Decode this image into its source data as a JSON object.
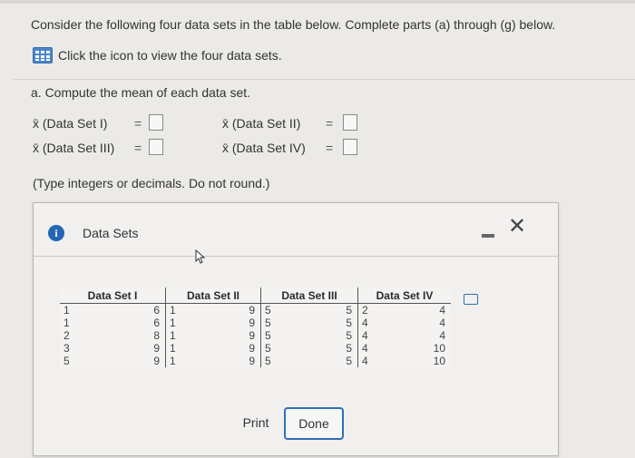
{
  "question": {
    "instruction": "Consider the following four data sets in the table below. Complete parts (a) through (g) below.",
    "click_text": "Click the icon to view the four data sets.",
    "part_a": "a. Compute the mean of each data set.",
    "means": [
      {
        "label": "x̄ (Data Set I)",
        "eq": "="
      },
      {
        "label": "x̄ (Data Set II)",
        "eq": "="
      },
      {
        "label": "x̄ (Data Set III)",
        "eq": "="
      },
      {
        "label": "x̄ (Data Set IV)",
        "eq": "="
      }
    ],
    "hint": "(Type integers or decimals. Do not round.)"
  },
  "modal": {
    "title": "Data Sets",
    "info_glyph": "i",
    "close_glyph": "✕",
    "headers": [
      "Data Set I",
      "Data Set II",
      "Data Set III",
      "Data Set IV"
    ],
    "rows": [
      [
        "1",
        "6",
        "1",
        "9",
        "5",
        "5",
        "2",
        "4"
      ],
      [
        "1",
        "6",
        "1",
        "9",
        "5",
        "5",
        "4",
        "4"
      ],
      [
        "2",
        "8",
        "1",
        "9",
        "5",
        "5",
        "4",
        "4"
      ],
      [
        "3",
        "9",
        "1",
        "9",
        "5",
        "5",
        "4",
        "10"
      ],
      [
        "5",
        "9",
        "1",
        "9",
        "5",
        "5",
        "4",
        "10"
      ]
    ],
    "print_label": "Print",
    "done_label": "Done"
  }
}
